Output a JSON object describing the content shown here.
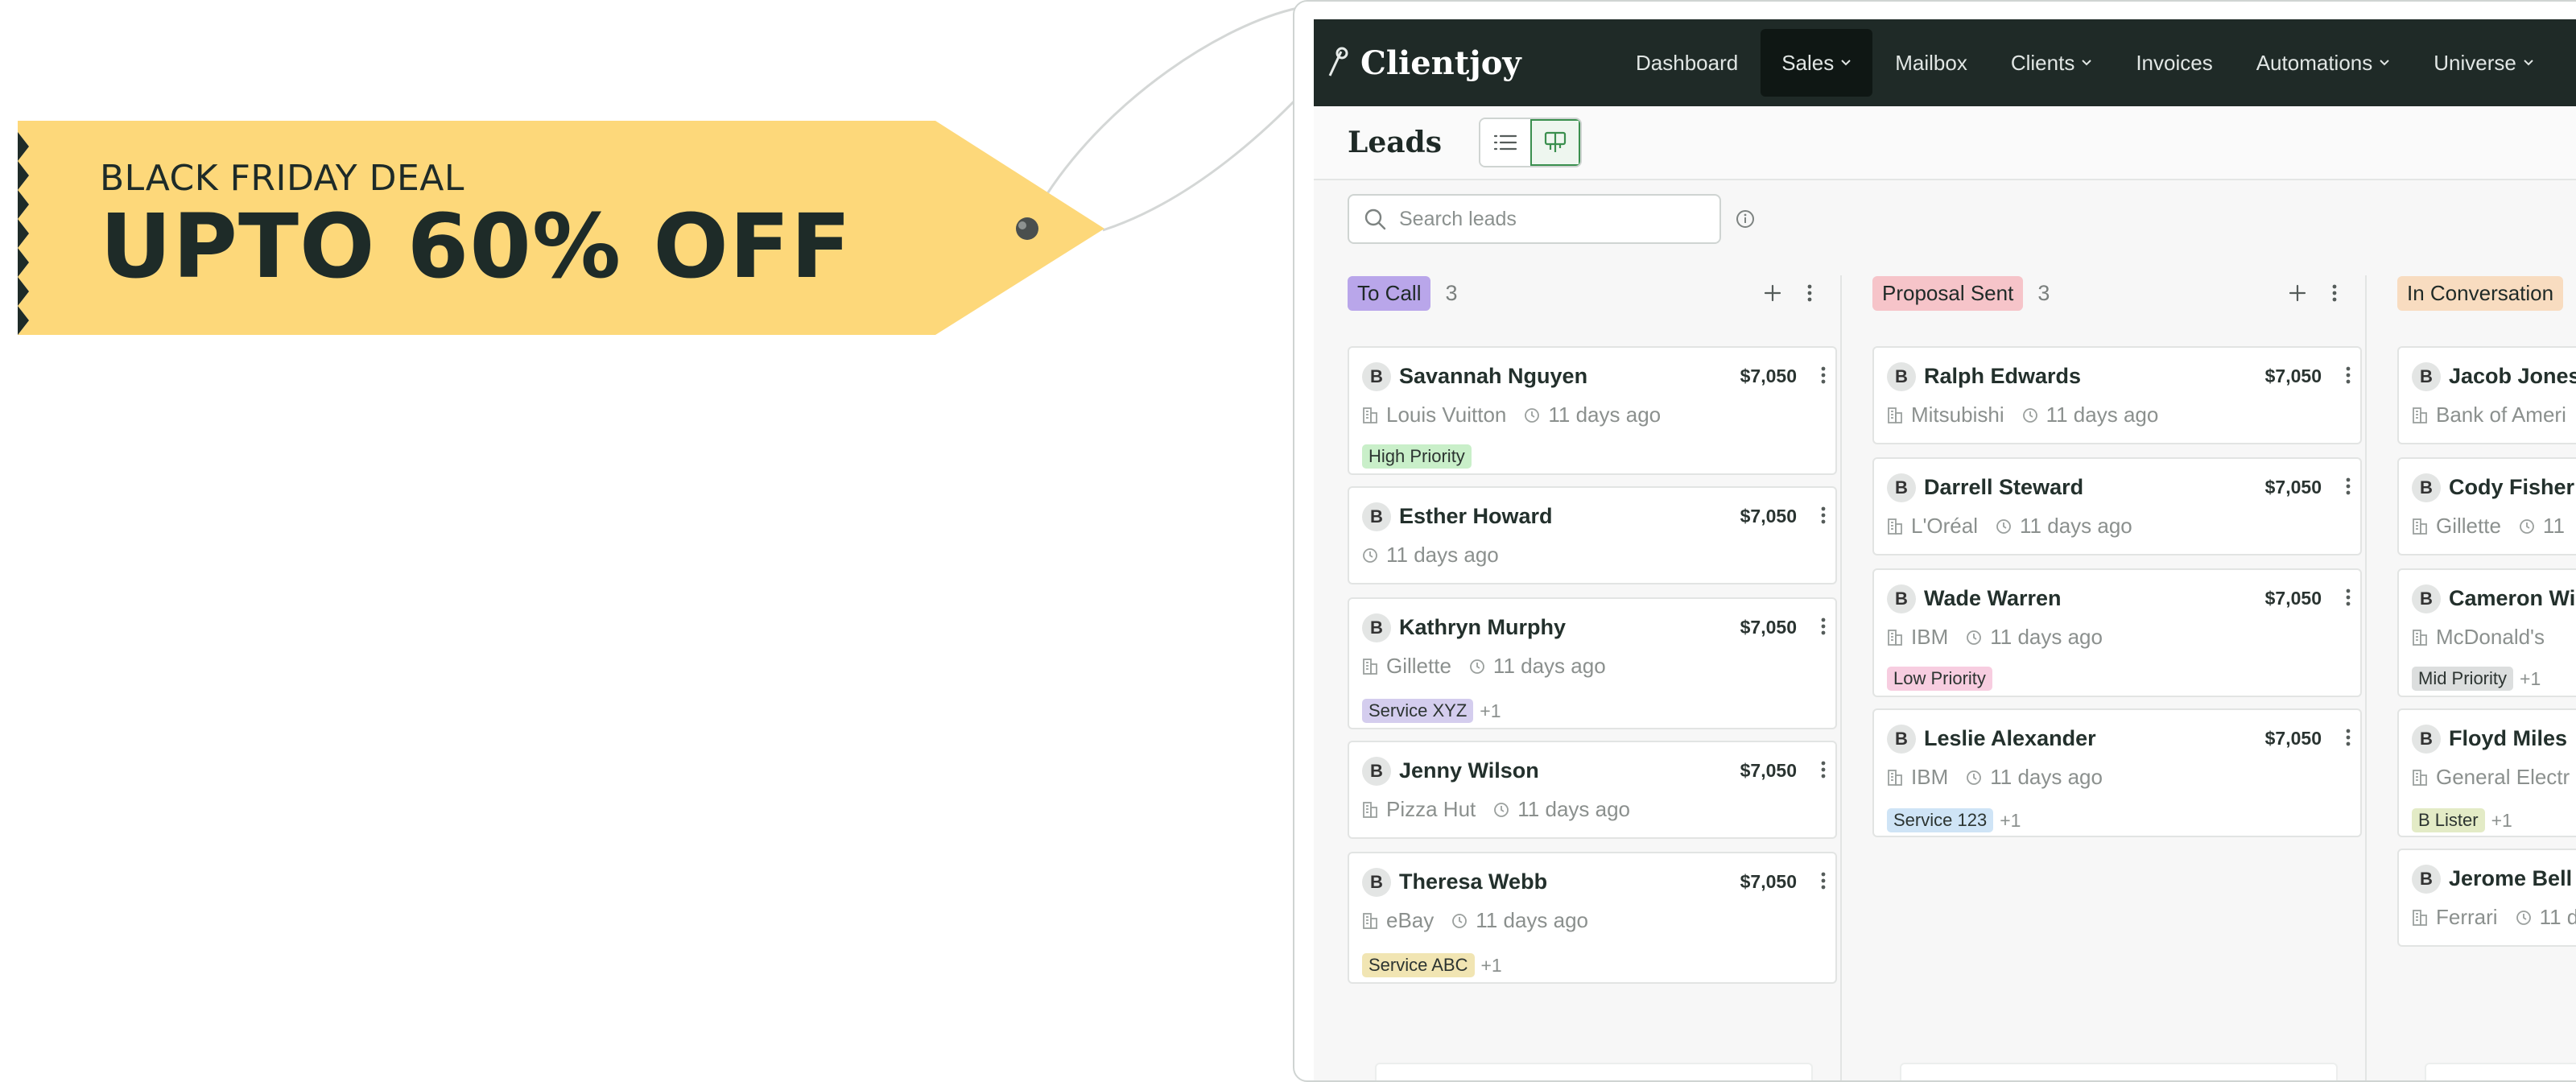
{
  "promo": {
    "eyebrow": "BLACK FRIDAY DEAL",
    "headline": "UPTO 60% OFF",
    "tag_color": "#fdd87a",
    "text_color": "#1e2b28"
  },
  "app": {
    "brand": "Clientjoy",
    "nav": [
      {
        "label": "Dashboard",
        "has_menu": false,
        "active": false
      },
      {
        "label": "Sales",
        "has_menu": true,
        "active": true
      },
      {
        "label": "Mailbox",
        "has_menu": false,
        "active": false
      },
      {
        "label": "Clients",
        "has_menu": true,
        "active": false
      },
      {
        "label": "Invoices",
        "has_menu": false,
        "active": false
      },
      {
        "label": "Automations",
        "has_menu": true,
        "active": false
      },
      {
        "label": "Universe",
        "has_menu": true,
        "active": false
      }
    ],
    "page_title": "Leads",
    "search": {
      "placeholder": "Search leads",
      "value": ""
    },
    "colors": {
      "nav_bg": "#1f2a27",
      "accent": "#3a8f4e"
    }
  },
  "board": {
    "columns": [
      {
        "title": "To Call",
        "count": "3",
        "pill_color": "#b9a6ea",
        "cards": [
          {
            "avatar": "B",
            "name": "Savannah Nguyen",
            "amount": "$7,050",
            "company": "Louis Vuitton",
            "time": "11 days ago",
            "tag": "High Priority",
            "tag_color": "#c9efc9",
            "extra": ""
          },
          {
            "avatar": "B",
            "name": "Esther Howard",
            "amount": "$7,050",
            "company": "",
            "time": "11 days ago",
            "tag": "",
            "tag_color": "",
            "extra": ""
          },
          {
            "avatar": "B",
            "name": "Kathryn Murphy",
            "amount": "$7,050",
            "company": "Gillette",
            "time": "11 days ago",
            "tag": "Service XYZ",
            "tag_color": "#d4cdee",
            "extra": "+1"
          },
          {
            "avatar": "B",
            "name": "Jenny Wilson",
            "amount": "$7,050",
            "company": "Pizza Hut",
            "time": "11 days ago",
            "tag": "",
            "tag_color": "",
            "extra": ""
          },
          {
            "avatar": "B",
            "name": "Theresa Webb",
            "amount": "$7,050",
            "company": "eBay",
            "time": "11 days ago",
            "tag": "Service ABC",
            "tag_color": "#f1e5b3",
            "extra": "+1"
          }
        ]
      },
      {
        "title": "Proposal Sent",
        "count": "3",
        "pill_color": "#f6c4c9",
        "cards": [
          {
            "avatar": "B",
            "name": "Ralph Edwards",
            "amount": "$7,050",
            "company": "Mitsubishi",
            "time": "11 days ago",
            "tag": "",
            "tag_color": "",
            "extra": ""
          },
          {
            "avatar": "B",
            "name": "Darrell Steward",
            "amount": "$7,050",
            "company": "L'Oréal",
            "time": "11 days ago",
            "tag": "",
            "tag_color": "",
            "extra": ""
          },
          {
            "avatar": "B",
            "name": "Wade Warren",
            "amount": "$7,050",
            "company": "IBM",
            "time": "11 days ago",
            "tag": "Low Priority",
            "tag_color": "#f7cde0",
            "extra": ""
          },
          {
            "avatar": "B",
            "name": "Leslie Alexander",
            "amount": "$7,050",
            "company": "IBM",
            "time": "11 days ago",
            "tag": "Service 123",
            "tag_color": "#cfe4f6",
            "extra": "+1"
          }
        ]
      },
      {
        "title": "In Conversation",
        "count": "",
        "pill_color": "#f8dcc0",
        "cards": [
          {
            "avatar": "B",
            "name": "Jacob Jones",
            "amount": "",
            "company": "Bank of Ameri",
            "time": "",
            "tag": "",
            "tag_color": "",
            "extra": ""
          },
          {
            "avatar": "B",
            "name": "Cody Fisher",
            "amount": "",
            "company": "Gillette",
            "time": "11",
            "tag": "",
            "tag_color": "",
            "extra": ""
          },
          {
            "avatar": "B",
            "name": "Cameron Wil",
            "amount": "",
            "company": "McDonald's",
            "time": "",
            "tag": "Mid Priority",
            "tag_color": "#dcdede",
            "extra": "+1"
          },
          {
            "avatar": "B",
            "name": "Floyd Miles",
            "amount": "",
            "company": "General Electr",
            "time": "",
            "tag": "B Lister",
            "tag_color": "#e3ebc6",
            "extra": "+1"
          },
          {
            "avatar": "B",
            "name": "Jerome Bell",
            "amount": "",
            "company": "Ferrari",
            "time": "11 d",
            "tag": "",
            "tag_color": "",
            "extra": ""
          }
        ]
      }
    ]
  }
}
